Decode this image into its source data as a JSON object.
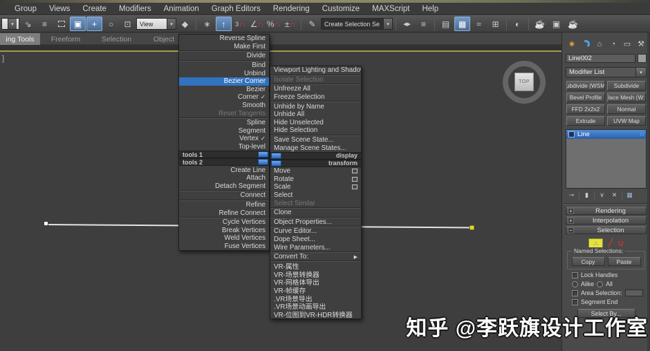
{
  "watermark": {
    "text": "知乎 @李跃旗设计工作室"
  },
  "menubar": {
    "items": [
      "Group",
      "Views",
      "Create",
      "Modifiers",
      "Animation",
      "Graph Editors",
      "Rendering",
      "Customize",
      "MAXScript",
      "Help"
    ]
  },
  "toolbar": {
    "view_dropdown": "View",
    "selection_set_dropdown": "Create Selection Se",
    "snap_number": "3"
  },
  "ribbon": {
    "tabs": [
      "ing Tools",
      "Freeform",
      "Selection",
      "Object"
    ]
  },
  "viewport": {
    "corner_label": "]",
    "viewcube_label": "TOP"
  },
  "quad_left": {
    "header1": "tools 1",
    "header2": "tools 2",
    "items": [
      "Reverse Spline",
      "Make First",
      "Divide",
      "Bind",
      "Unbind",
      "Bezier Corner",
      "Bezier",
      "Corner",
      "Smooth",
      "Reset Tangents",
      "Spline",
      "Segment",
      "Vertex",
      "Top-level",
      "Create Line",
      "Attach",
      "Detach Segment",
      "Connect",
      "Refine",
      "Refine Connect",
      "Cycle Vertices",
      "Break Vertices",
      "Weld Vertices",
      "Fuse Vertices"
    ]
  },
  "quad_right": {
    "header1": "display",
    "header2": "transform",
    "items": [
      "Viewport Lighting and Shadows",
      "Isolate Selection",
      "Unfreeze All",
      "Freeze Selection",
      "Unhide by Name",
      "Unhide All",
      "Hide Unselected",
      "Hide Selection",
      "Save Scene State...",
      "Manage Scene States...",
      "Move",
      "Rotate",
      "Scale",
      "Select",
      "Select Similar",
      "Clone",
      "Object Properties...",
      "Curve Editor...",
      "Dope Sheet...",
      "Wire Parameters...",
      "Convert To:",
      "VR-属性",
      "VR-场景转换器",
      "VR-网格体导出",
      "VR-帧缓存",
      ".VR场景导出",
      ".VR场景动画导出",
      "VR-位图到VR-HDR转换器"
    ]
  },
  "panel": {
    "object_name": "Line002",
    "modifier_list": "Modifier List",
    "buttons": [
      "ubdivide (WSM",
      "Subdivide",
      "Bevel Profile",
      "lace Mesh (W:",
      "FFD 2x2x2",
      "Normal",
      "Extrude",
      "UVW Map"
    ],
    "stack_item": "Line",
    "rollout_rendering": "Rendering",
    "rollout_interpolation": "Interpolation",
    "rollout_selection": "Selection",
    "named_selections": "Named Selections:",
    "copy": "Copy",
    "paste": "Paste",
    "lock_handles": "Lock Handles",
    "alike": "Alike",
    "all": "All",
    "area_selection": "Area Selection:",
    "segment_end": "Segment End",
    "select_by": "Select By..."
  },
  "colors": {
    "accent_blue": "#3273c0",
    "active_viewport_border": "#a89c52",
    "vertex_yellow": "#ecd52d",
    "subobject_red": "#c0392b"
  },
  "icons": {
    "arrow_down": "▾",
    "arrow_right": "▶",
    "check": "✓",
    "link": "⇘",
    "byname": "≡",
    "wincross": "▣",
    "move": "+",
    "rotate": "○",
    "scale": "⊡",
    "pivot": "◆",
    "manip": "∗",
    "kbd": "↑",
    "magnet": "∩",
    "angle": "∠",
    "percent": "%",
    "spinner": "±",
    "editsets": "✎",
    "mirror": "◀▶",
    "align": "≡",
    "layers": "▤",
    "ribbon_toggle": "▦",
    "curve": "≈",
    "schematic": "⊞",
    "material": "◐",
    "render_setup": "☕",
    "render_frame": "▣",
    "render_prod": "☕",
    "tab_create": "∗",
    "tab_hierarchy": "⌂",
    "tab_motion": "◔",
    "tab_display": "▭",
    "tab_utils": "⚒",
    "pin": "⊸",
    "end_result": "▮",
    "make_unique": "∨",
    "remove_mod": "✕",
    "config_sets": "▦",
    "stack_dots": "∷",
    "segment_glyph": "╱",
    "spline_glyph": "∪",
    "plus": "+",
    "minus": "−",
    "vertex_dots": "∴"
  }
}
